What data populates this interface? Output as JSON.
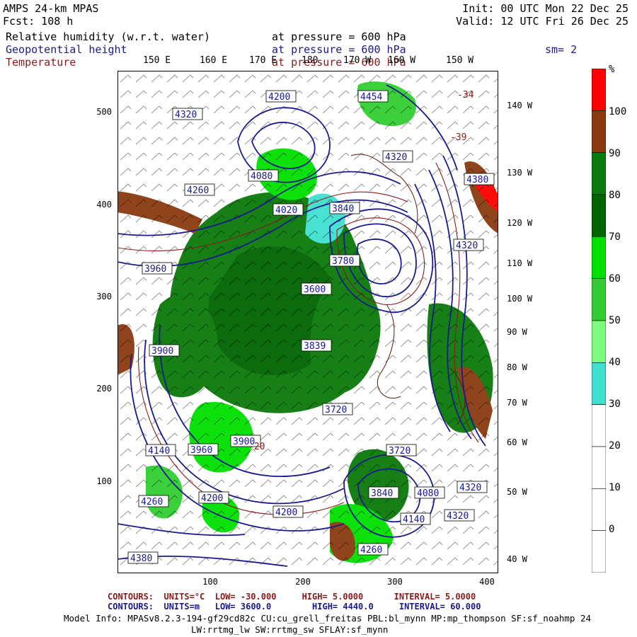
{
  "header": {
    "model": "AMPS 24-km MPAS",
    "fcst": "Fcst: 108 h",
    "init": "Init: 00 UTC Mon 22 Dec 25",
    "valid": "Valid: 12 UTC Fri 26 Dec 25",
    "fields": [
      {
        "name": "Relative humidity (w.r.t. water)",
        "level": "at pressure = 600 hPa",
        "color": "#000000"
      },
      {
        "name": "Geopotential height",
        "level": "at pressure = 600 hPa",
        "color": "#1a1a8c"
      },
      {
        "name": "Temperature",
        "level": "at pressure = 600 hPa",
        "color": "#8b1a1a"
      }
    ],
    "smoothing": "sm= 2"
  },
  "map": {
    "lon_labels_top": [
      "150 E",
      "160 E",
      "170 E",
      "180",
      "170 W",
      "160 W",
      "150 W"
    ],
    "lon_labels_right": [
      "140 W",
      "130 W",
      "120 W",
      "110 W",
      "100 W",
      "90 W",
      "80 W",
      "70 W",
      "60 W",
      "50 W",
      "40 W"
    ],
    "y_ticks": [
      "500",
      "400",
      "300",
      "200",
      "100"
    ],
    "x_ticks": [
      "100",
      "200",
      "300",
      "400"
    ],
    "height_labels": [
      "4200",
      "4320",
      "4454",
      "4320",
      "4380",
      "4260",
      "4080",
      "3840",
      "4020",
      "3780",
      "3960",
      "3600",
      "3839",
      "3900",
      "4140",
      "4200",
      "4260",
      "4380",
      "4320",
      "4080",
      "3840",
      "3720",
      "4140",
      "4320",
      "3960",
      "3900",
      "3720",
      "4260",
      "4320",
      "4200"
    ],
    "temp_labels": [
      "-34",
      "-39",
      "-20"
    ],
    "colors": {
      "land_outline": "#5a1a10",
      "height_contour": "#1a1a8c",
      "temp_contour": "#8b1a1a",
      "barb": "#000000"
    }
  },
  "colorbar": {
    "unit": "%",
    "labels": [
      "100",
      "90",
      "80",
      "70",
      "60",
      "50",
      "40",
      "30",
      "20",
      "10",
      "0"
    ],
    "bins": [
      {
        "from": 100,
        "to": null,
        "color": "#ff0000"
      },
      {
        "from": 90,
        "to": 100,
        "color": "#8b3a0f"
      },
      {
        "from": 80,
        "to": 90,
        "color": "#0a7a0a"
      },
      {
        "from": 70,
        "to": 80,
        "color": "#006400"
      },
      {
        "from": 60,
        "to": 70,
        "color": "#00e000"
      },
      {
        "from": 50,
        "to": 60,
        "color": "#32cd32"
      },
      {
        "from": 40,
        "to": 50,
        "color": "#7cfc7c"
      },
      {
        "from": 30,
        "to": 40,
        "color": "#40e0d0"
      },
      {
        "from": 20,
        "to": 30,
        "color": "#ffffff"
      },
      {
        "from": 10,
        "to": 20,
        "color": "#ffffff"
      },
      {
        "from": 0,
        "to": 10,
        "color": "#ffffff"
      },
      {
        "from": null,
        "to": 0,
        "color": "#ffffff"
      }
    ]
  },
  "footer": {
    "contours_temp": {
      "label": "CONTOURS:",
      "units": "UNITS=°C",
      "low": "LOW= -30.000",
      "high": "HIGH= 5.0000",
      "interval": "INTERVAL= 5.0000",
      "color": "#8b1a1a"
    },
    "contours_height": {
      "label": "CONTOURS:",
      "units": "UNITS=m",
      "low": "LOW= 3600.0",
      "high": "HIGH= 4440.0",
      "interval": "INTERVAL= 60.000",
      "color": "#1a1a8c"
    },
    "model_info_1": "Model Info: MPASv8.2.3-194-gf29cd82c CU:cu_grell_freitas PBL:bl_mynn MP:mp_thompson SF:sf_noahmp 24",
    "model_info_2": "LW:rrtmg_lw SW:rrtmg_sw SFLAY:sf_mynn"
  }
}
